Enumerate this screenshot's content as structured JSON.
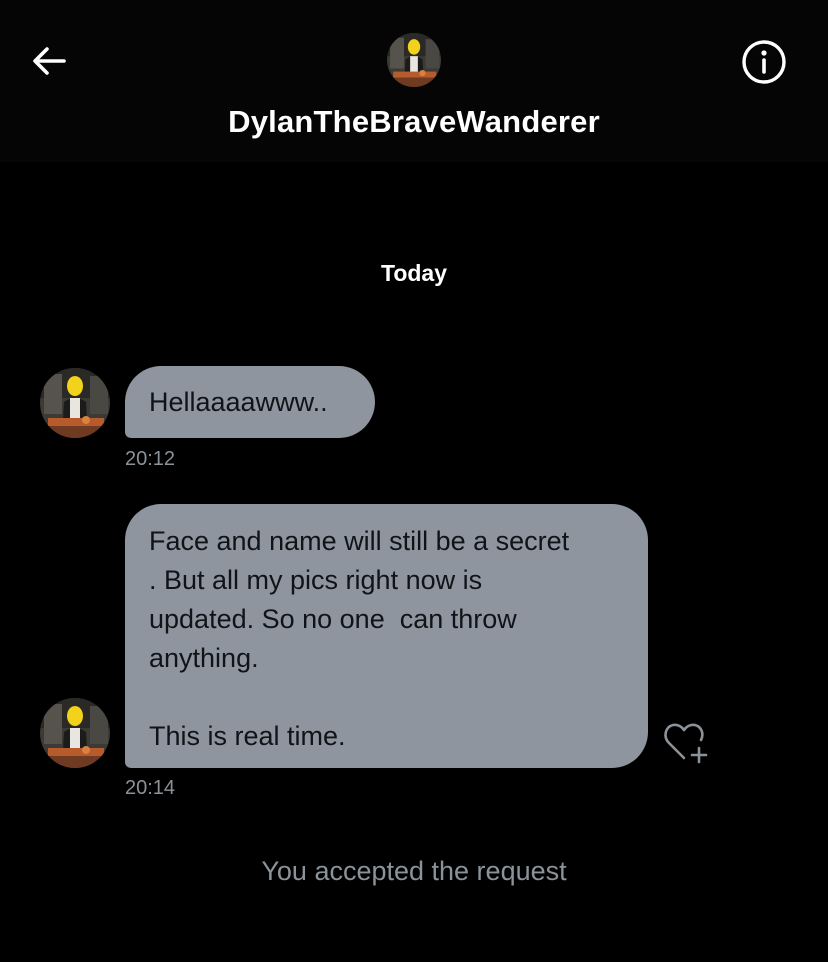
{
  "header": {
    "back_icon": "arrow-left-icon",
    "info_icon": "info-circle-icon",
    "username": "DylanTheBraveWanderer"
  },
  "conversation": {
    "date_separator": "Today",
    "messages": [
      {
        "text": "Hellaaaawww..",
        "time": "20:12"
      },
      {
        "text": "Face and name will still be a secret\n. But all my pics right now is\nupdated. So no one  can throw\nanything.\n\nThis is real time.",
        "time": "20:14",
        "action_icon": "heart-plus-icon"
      }
    ],
    "system_message": "You accepted the request"
  },
  "colors": {
    "background": "#000000",
    "bubble": "#8e959e",
    "muted_text": "#8b9298",
    "title_text": "#ffffff"
  }
}
